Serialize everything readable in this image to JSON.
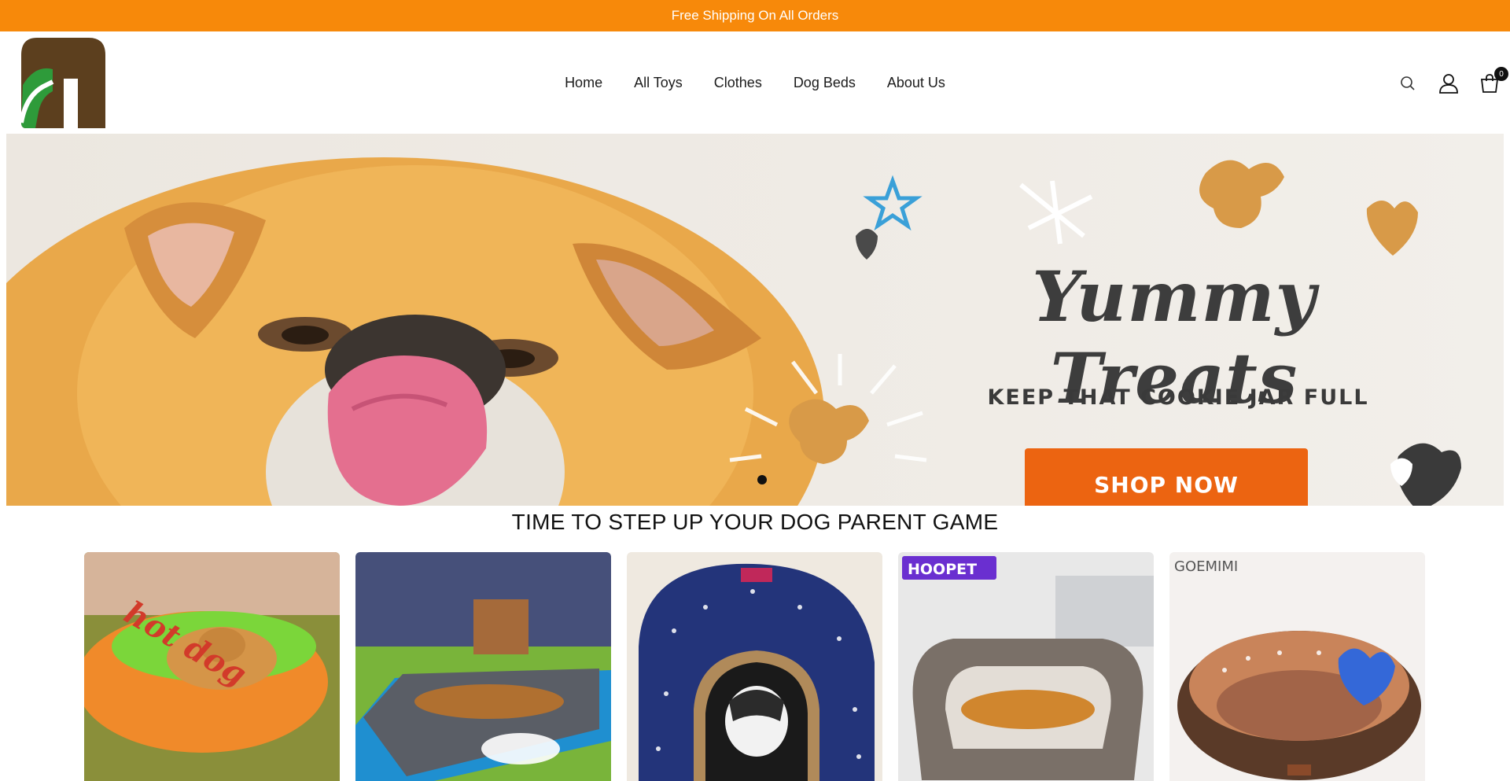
{
  "announcement": "Free Shipping On All Orders",
  "nav": {
    "items": [
      {
        "label": "Home"
      },
      {
        "label": "All Toys"
      },
      {
        "label": "Clothes"
      },
      {
        "label": "Dog Beds"
      },
      {
        "label": "About Us"
      }
    ]
  },
  "header_icons": {
    "search": "search-icon",
    "account": "account-icon",
    "cart": "cart-icon",
    "cart_count": "0"
  },
  "hero": {
    "title": "Yummy Treats",
    "subtitle": "KEEP THAT COOKIE JAR FULL",
    "button": "SHOP NOW",
    "slide_dots": 1
  },
  "section": {
    "title": "TIME TO STEP UP YOUR DOG PARENT GAME"
  },
  "products": [
    {
      "name": "hot-dog-bed",
      "image_text": "hot dog"
    },
    {
      "name": "cooling-mat-bed",
      "image_text": ""
    },
    {
      "name": "star-dog-house",
      "image_text": ""
    },
    {
      "name": "grey-sofa-bed",
      "image_text": "HOOPET"
    },
    {
      "name": "brown-polka-bed",
      "image_text": "GOEMIMI"
    }
  ],
  "colors": {
    "announcement_bg": "#f7890a",
    "button": "#ec6411",
    "logo_brown": "#5c3f1e",
    "logo_green": "#2e9b3a"
  }
}
